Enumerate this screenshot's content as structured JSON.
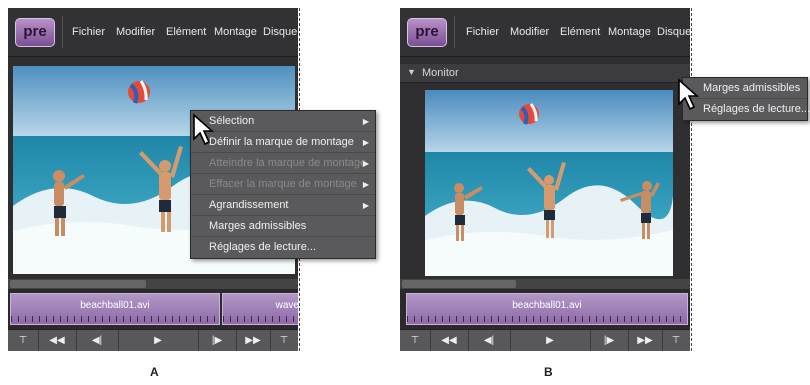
{
  "menubar": {
    "logo": "pre",
    "items": [
      "Fichier",
      "Modifier",
      "Elément",
      "Montage",
      "Disque"
    ]
  },
  "monitor_title": "Monitor",
  "clips": {
    "a1": "beachball01.avi",
    "a2": "wave",
    "b1": "beachball01.avi"
  },
  "context_menu_a": [
    {
      "label": "Sélection",
      "submenu": true,
      "enabled": true
    },
    {
      "label": "Définir la marque de montage",
      "submenu": true,
      "enabled": true
    },
    {
      "label": "Atteindre la marque de montage",
      "submenu": true,
      "enabled": false
    },
    {
      "label": "Effacer la marque de montage",
      "submenu": true,
      "enabled": false
    },
    {
      "label": "Agrandissement",
      "submenu": true,
      "enabled": true
    },
    {
      "label": "Marges admissibles",
      "submenu": false,
      "enabled": true
    },
    {
      "label": "Réglages de lecture...",
      "submenu": false,
      "enabled": true
    }
  ],
  "context_menu_b": [
    {
      "label": "Marges admissibles"
    },
    {
      "label": "Réglages de lecture..."
    }
  ],
  "transport": {
    "icons": [
      "trim-start-icon",
      "rewind-icon",
      "step-back-icon",
      "play-icon",
      "step-forward-icon",
      "fast-forward-icon",
      "trim-end-icon"
    ],
    "glyphs": [
      "⊤",
      "◀◀",
      "◀|",
      "▶",
      "|▶",
      "▶▶",
      "⊤"
    ]
  },
  "captions": {
    "a": "A",
    "b": "B"
  }
}
